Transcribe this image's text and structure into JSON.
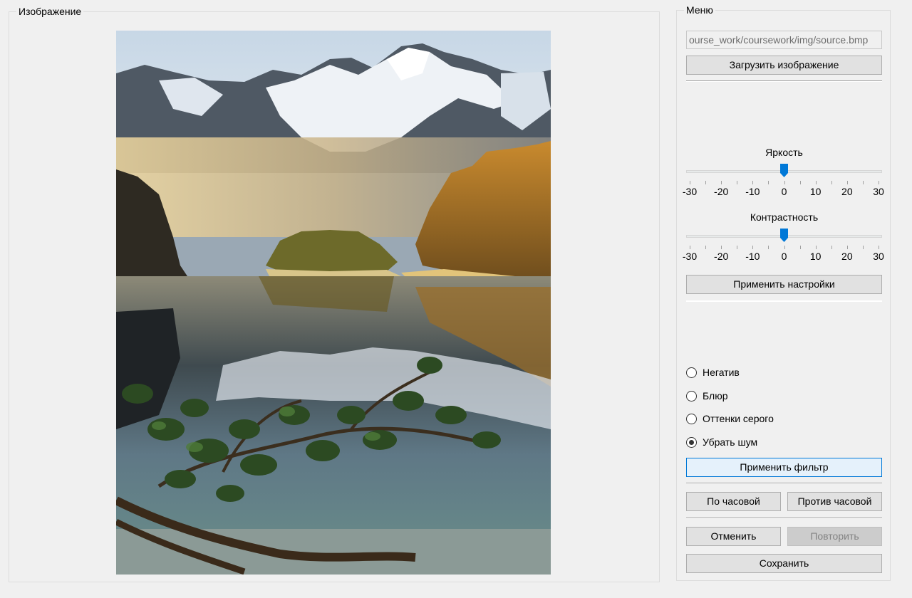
{
  "image_panel": {
    "title": "Изображение",
    "image_description": "mountain lake landscape with snowy peaks, autumn forest and pine branch"
  },
  "menu": {
    "title": "Меню",
    "path_value": "ourse_work/coursework/img/source.bmp",
    "load_button": "Загрузить изображение",
    "brightness": {
      "label": "Яркость",
      "min": -30,
      "max": 30,
      "value": 0,
      "ticks": [
        "-30",
        "-20",
        "-10",
        "0",
        "10",
        "20",
        "30"
      ]
    },
    "contrast": {
      "label": "Контрастность",
      "min": -30,
      "max": 30,
      "value": 0,
      "ticks": [
        "-30",
        "-20",
        "-10",
        "0",
        "10",
        "20",
        "30"
      ]
    },
    "apply_settings_button": "Применить настройки",
    "filters": [
      {
        "label": "Негатив",
        "checked": false
      },
      {
        "label": "Блюр",
        "checked": false
      },
      {
        "label": "Оттенки серого",
        "checked": false
      },
      {
        "label": "Убрать шум",
        "checked": true
      }
    ],
    "apply_filter_button": "Применить фильтр",
    "rotate_cw_button": "По часовой",
    "rotate_ccw_button": "Против часовой",
    "undo_button": "Отменить",
    "redo_button": "Повторить",
    "redo_enabled": false,
    "save_button": "Сохранить"
  },
  "colors": {
    "window_bg": "#f0f0f0",
    "accent": "#0078d7",
    "button_bg": "#e1e1e1",
    "focused_button_bg": "#e5f1fb"
  }
}
